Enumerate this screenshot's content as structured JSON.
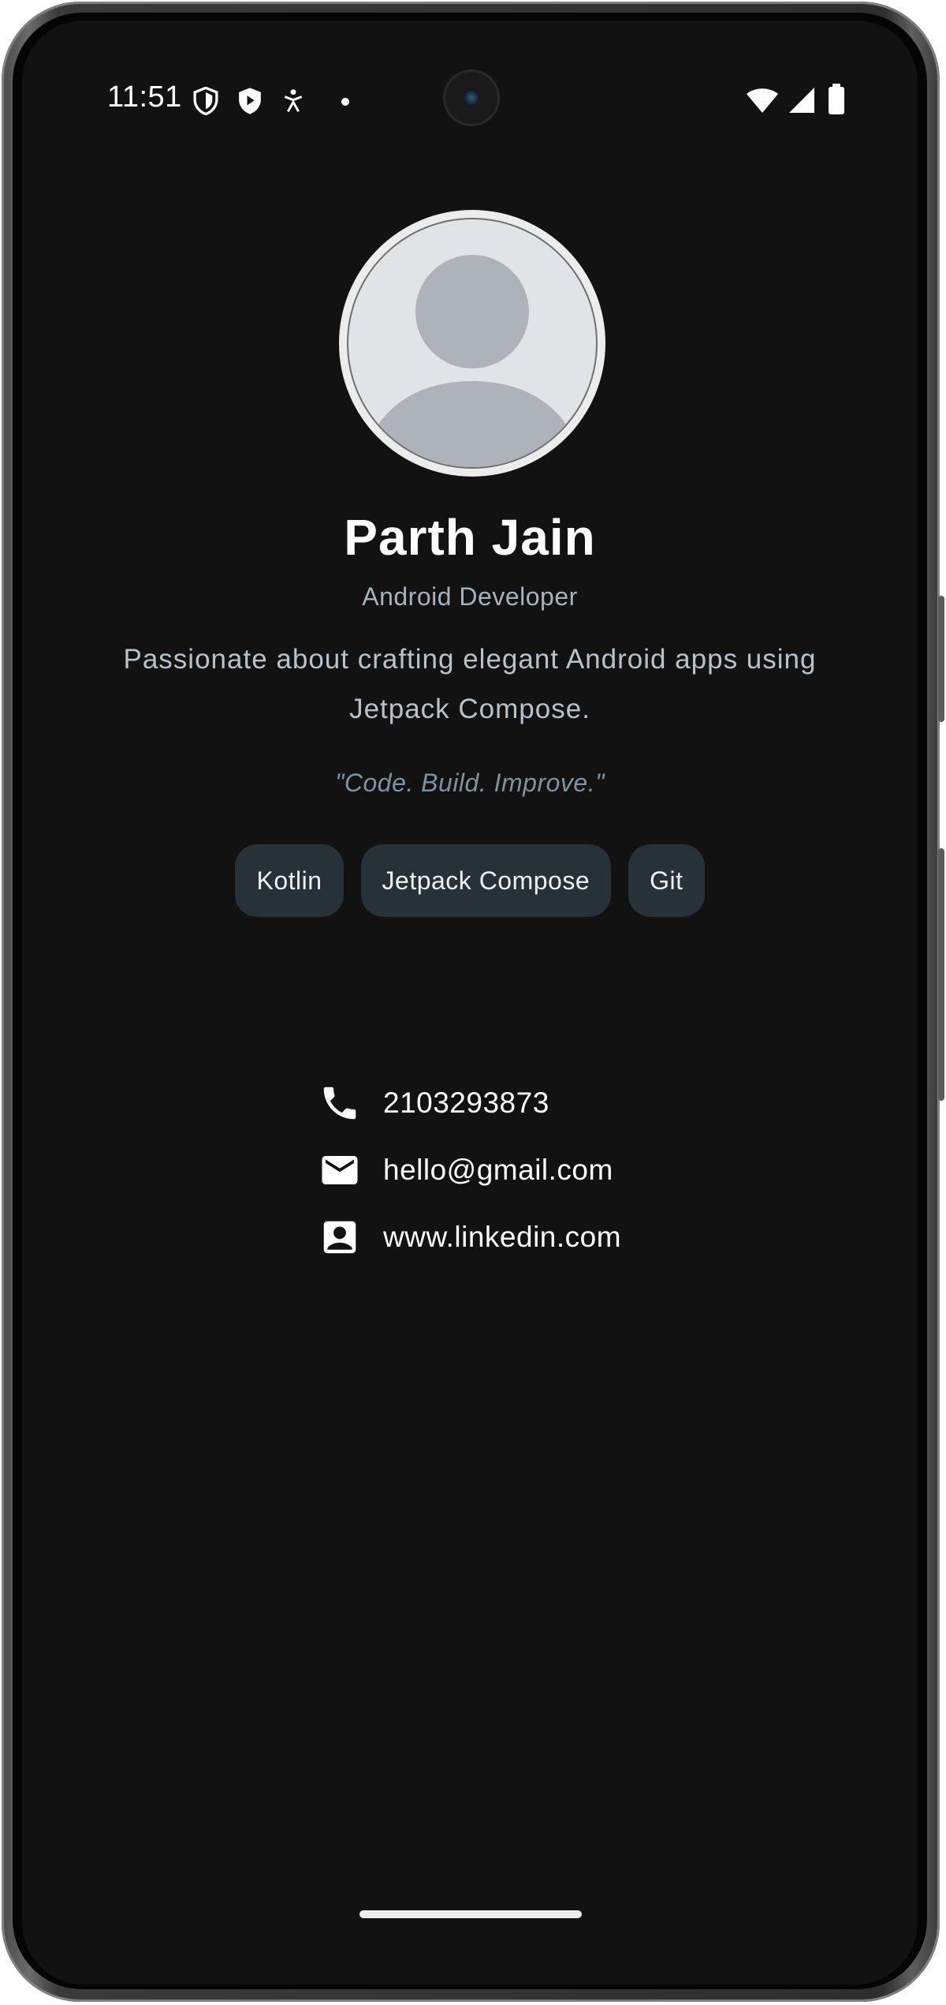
{
  "status_bar": {
    "time": "11:51",
    "left_icons": [
      "shield-outline-icon",
      "play-shield-icon",
      "accessibility-icon",
      "dot-icon"
    ],
    "right_icons": [
      "wifi-icon",
      "cell-signal-icon",
      "battery-icon"
    ]
  },
  "profile": {
    "name": "Parth Jain",
    "role": "Android Developer",
    "bio": "Passionate about crafting elegant Android apps using Jetpack Compose.",
    "quote": "\"Code. Build. Improve.\""
  },
  "skills": [
    "Kotlin",
    "Jetpack Compose",
    "Git"
  ],
  "contacts": [
    {
      "icon": "phone-icon",
      "text": "2103293873"
    },
    {
      "icon": "email-icon",
      "text": "hello@gmail.com"
    },
    {
      "icon": "contact-card-icon",
      "text": "www.linkedin.com"
    }
  ],
  "colors": {
    "background": "#121212",
    "chip_background": "#263238",
    "secondary_text": "#a7b3bc",
    "quote_text": "#7f939e"
  }
}
